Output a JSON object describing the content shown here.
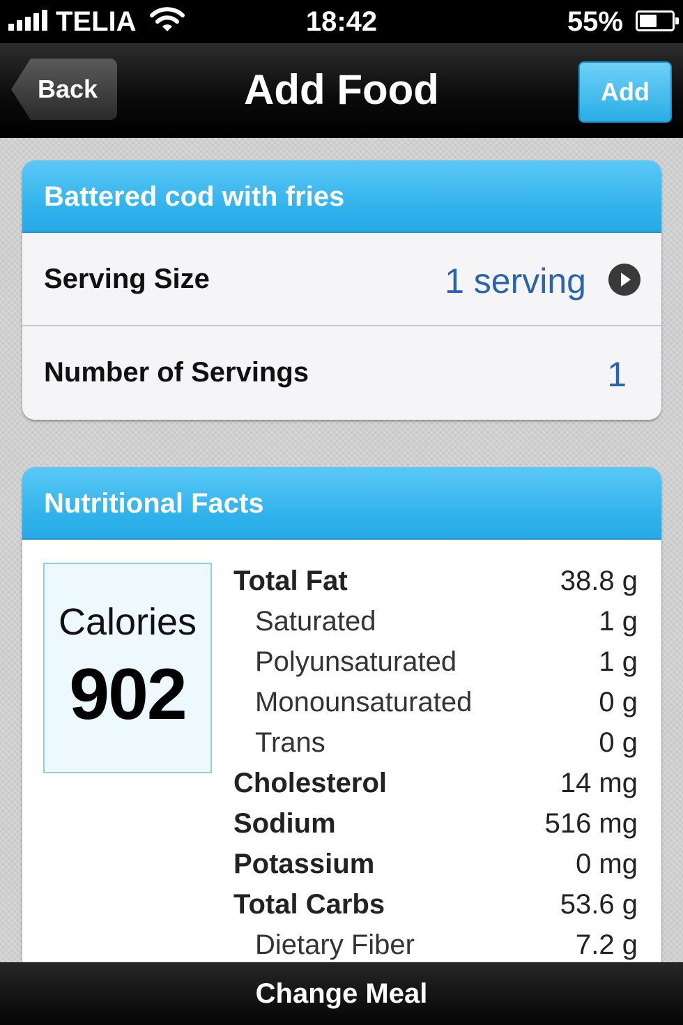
{
  "status_bar": {
    "carrier": "TELIA",
    "time": "18:42",
    "battery": "55%",
    "battery_level": 0.55
  },
  "nav": {
    "back_label": "Back",
    "title": "Add Food",
    "add_label": "Add"
  },
  "food": {
    "name": "Battered cod with fries",
    "serving_size_label": "Serving Size",
    "serving_size_value": "1 serving",
    "servings_label": "Number of Servings",
    "servings_value": "1"
  },
  "nutrition": {
    "header": "Nutritional Facts",
    "calories_label": "Calories",
    "calories_value": "902",
    "items": [
      {
        "name": "Total Fat",
        "amount": "38.8 g",
        "level": "main"
      },
      {
        "name": "Saturated",
        "amount": "1 g",
        "level": "sub"
      },
      {
        "name": "Polyunsaturated",
        "amount": "1 g",
        "level": "sub"
      },
      {
        "name": "Monounsaturated",
        "amount": "0 g",
        "level": "sub"
      },
      {
        "name": "Trans",
        "amount": "0 g",
        "level": "sub"
      },
      {
        "name": "Cholesterol",
        "amount": "14 mg",
        "level": "main"
      },
      {
        "name": "Sodium",
        "amount": "516 mg",
        "level": "main"
      },
      {
        "name": "Potassium",
        "amount": "0 mg",
        "level": "main"
      },
      {
        "name": "Total Carbs",
        "amount": "53.6 g",
        "level": "main"
      },
      {
        "name": "Dietary Fiber",
        "amount": "7.2 g",
        "level": "sub"
      }
    ]
  },
  "toolbar": {
    "change_meal_label": "Change Meal"
  },
  "colors": {
    "accent": "#2fb1ec",
    "value_text": "#2a64b0"
  }
}
